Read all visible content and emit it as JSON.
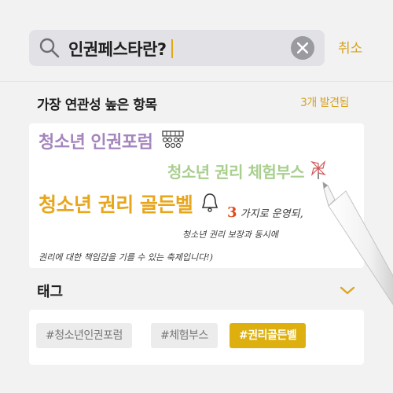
{
  "search": {
    "query": "인권페스타란?",
    "cancel_label": "취소"
  },
  "results": {
    "heading": "가장 연관성 높은 항목",
    "count_label": "3개 발견됨",
    "card": {
      "line1": "청소년 인권포럼",
      "line2": "청소년 권리 체험부스",
      "line3": "청소년 권리 골든벨",
      "handwriting_number": "3",
      "handwriting_1": "가지로 운영되,",
      "handwriting_2": "청소년 권리 보장과 동시에",
      "handwriting_3": "권리에 대한 책임감을 기를 수 있는 축제입니다!)"
    }
  },
  "tags": {
    "heading": "태그",
    "items": [
      {
        "label": "#청소년인권포럼"
      },
      {
        "label": "#체험부스"
      },
      {
        "label": "#권리골든벨"
      }
    ]
  },
  "colors": {
    "accent": "#d6a21f",
    "forum": "#a585bd",
    "booth": "#a9cf8f",
    "goldenbell": "#e8a61d",
    "active_tag": "#ddb00f"
  }
}
